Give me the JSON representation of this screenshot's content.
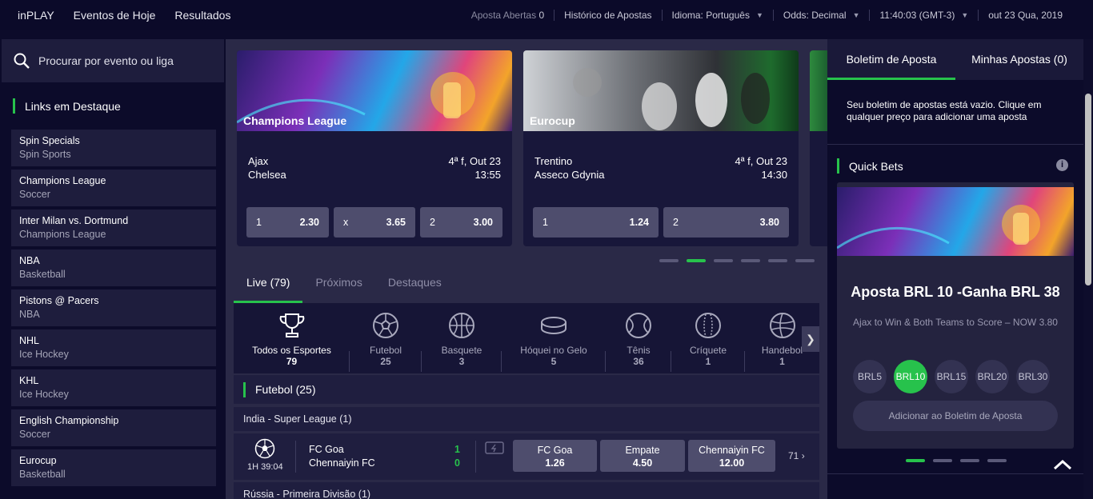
{
  "nav": {
    "items": [
      "inPLAY",
      "Eventos de Hoje",
      "Resultados"
    ]
  },
  "topbar": {
    "open_bets_label": "Aposta Abertas",
    "open_bets_count": "0",
    "history": "Histórico de Apostas",
    "language_label": "Idioma:",
    "language_value": "Português",
    "odds_label": "Odds:",
    "odds_value": "Decimal",
    "time": "11:40:03",
    "timezone": "(GMT-3)",
    "date": "out 23 Qua, 2019"
  },
  "search": {
    "placeholder": "Procurar por evento ou liga"
  },
  "featured": {
    "title": "Links em Destaque",
    "items": [
      {
        "title": "Spin Specials",
        "sub": "Spin Sports"
      },
      {
        "title": "Champions League",
        "sub": "Soccer"
      },
      {
        "title": "Inter Milan vs. Dortmund",
        "sub": "Champions League"
      },
      {
        "title": "NBA",
        "sub": "Basketball"
      },
      {
        "title": "Pistons @ Pacers",
        "sub": "NBA"
      },
      {
        "title": "NHL",
        "sub": "Ice Hockey"
      },
      {
        "title": "KHL",
        "sub": "Ice Hockey"
      },
      {
        "title": "English Championship",
        "sub": "Soccer"
      },
      {
        "title": "Eurocup",
        "sub": "Basketball"
      }
    ]
  },
  "cards": [
    {
      "league": "Champions League",
      "home": "Ajax",
      "away": "Chelsea",
      "date": "4ª f, Out 23",
      "time": "13:55",
      "odds": [
        {
          "label": "1",
          "value": "2.30"
        },
        {
          "label": "x",
          "value": "3.65"
        },
        {
          "label": "2",
          "value": "3.00"
        }
      ]
    },
    {
      "league": "Eurocup",
      "home": "Trentino",
      "away": "Asseco Gdynia",
      "date": "4ª f, Out 23",
      "time": "14:30",
      "odds": [
        {
          "label": "1",
          "value": "1.24"
        },
        {
          "label": "2",
          "value": "3.80"
        }
      ]
    }
  ],
  "tabs": [
    "Live (79)",
    "Próximos",
    "Destaques"
  ],
  "sports": [
    {
      "name": "Todos os Esportes",
      "count": "79",
      "icon": "trophy-icon"
    },
    {
      "name": "Futebol",
      "count": "25",
      "icon": "soccer-ball-icon"
    },
    {
      "name": "Basquete",
      "count": "3",
      "icon": "basketball-icon"
    },
    {
      "name": "Hóquei no Gelo",
      "count": "5",
      "icon": "hockey-puck-icon"
    },
    {
      "name": "Tênis",
      "count": "36",
      "icon": "tennis-ball-icon"
    },
    {
      "name": "Críquete",
      "count": "1",
      "icon": "cricket-ball-icon"
    },
    {
      "name": "Handebol",
      "count": "1",
      "icon": "handball-icon"
    }
  ],
  "section": {
    "title": "Futebol (25)"
  },
  "leagues": [
    "India - Super League (1)",
    "Rússia - Primeira Divisão (1)"
  ],
  "match": {
    "clock": "1H 39:04",
    "home": "FC Goa",
    "away": "Chennaiyin FC",
    "home_score": "1",
    "away_score": "0",
    "odds": [
      {
        "label": "FC Goa",
        "value": "1.26"
      },
      {
        "label": "Empate",
        "value": "4.50"
      },
      {
        "label": "Chennaiyin FC",
        "value": "12.00"
      }
    ],
    "more": "71"
  },
  "betslip": {
    "tab1": "Boletim de Aposta",
    "tab2": "Minhas Apostas (0)",
    "empty": "Seu boletim de apostas está vazio. Clique em qualquer preço para adicionar uma aposta"
  },
  "quickbets": {
    "title": "Quick Bets",
    "promo_title": "Aposta BRL 10 -Ganha BRL 38",
    "promo_desc": "Ajax to Win & Both Teams to Score – NOW 3.80",
    "chips": [
      "BRL5",
      "BRL10",
      "BRL15",
      "BRL20",
      "BRL30"
    ],
    "selected_chip": "BRL10",
    "add_label": "Adicionar ao Boletim de Aposta"
  },
  "colors": {
    "accent": "#27c24c",
    "background": "#0c0b2a",
    "panel": "#1e1d3d",
    "odds_button": "#4e4d6d"
  }
}
